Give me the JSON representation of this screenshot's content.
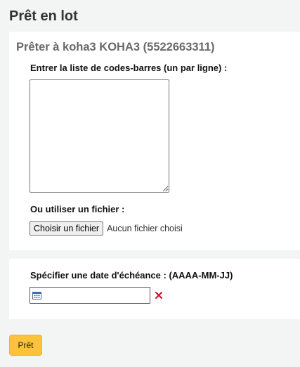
{
  "page": {
    "title": "Prêt en lot"
  },
  "checkout_panel": {
    "heading": "Prêter à koha3 KOHA3 (5522663311)",
    "barcodes_label": "Entrer la liste de codes-barres (un par ligne) :",
    "barcodes_value": "",
    "file_label": "Ou utiliser un fichier :",
    "file_button_label": "Choisir un fichier",
    "file_status": "Aucun fichier choisi"
  },
  "due_date_panel": {
    "label": "Spécifier une date d'échéance : (AAAA-MM-JJ)",
    "date_value": "",
    "calendar_icon": "calendar-icon",
    "clear_icon": "clear-date-icon"
  },
  "actions": {
    "submit_label": "Prêt"
  },
  "colors": {
    "background": "#f3f4f4",
    "panel": "#ffffff",
    "heading": "#696969",
    "submit": "#fbc23a",
    "clear_icon": "#c8102e"
  }
}
